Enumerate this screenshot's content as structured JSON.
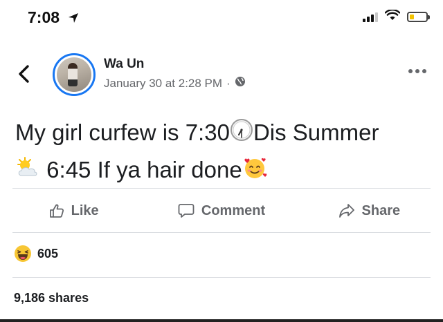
{
  "status_bar": {
    "time": "7:08",
    "battery_level": 0.25,
    "battery_color": "#f2c200",
    "icons": [
      "location-arrow-icon",
      "signal-bars-icon",
      "wifi-icon",
      "battery-icon"
    ]
  },
  "post": {
    "author": "Wa Un",
    "date": "January 30 at 2:28 PM",
    "meta_separator": "·",
    "audience_icon": "globe-icon",
    "text_parts": [
      "My girl curfew is 7:30",
      "Dis Summer",
      "6:45 If ya hair done"
    ],
    "text_emojis": [
      "clock-730-emoji",
      "sun-behind-cloud-emoji",
      "smiling-face-with-hearts-emoji"
    ]
  },
  "actions": {
    "like": "Like",
    "comment": "Comment",
    "share": "Share"
  },
  "reactions": {
    "icon": "laughing-reaction-icon",
    "count": "605"
  },
  "shares": "9,186 shares",
  "colors": {
    "accent": "#1877f2",
    "meta_gray": "#65676b",
    "text": "#1c1e21",
    "divider": "#dadde1"
  }
}
